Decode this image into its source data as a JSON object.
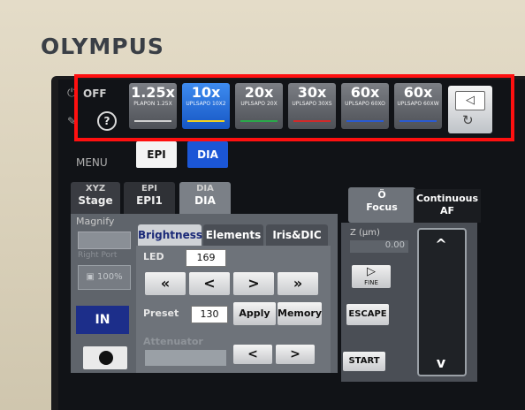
{
  "brand": "OLYMPUS",
  "power": {
    "label": "OFF"
  },
  "help": {
    "label": "?"
  },
  "objectives": [
    {
      "mag": "1.25x",
      "name": "PLAPON 1.25X",
      "stripe": "#cfcfcf",
      "active": false
    },
    {
      "mag": "10x",
      "name": "UPLSAPO 10X2",
      "stripe": "#f0d020",
      "active": true
    },
    {
      "mag": "20x",
      "name": "UPLSAPO 20X",
      "stripe": "#2aa84a",
      "active": false
    },
    {
      "mag": "30x",
      "name": "UPLSAPO 30XS",
      "stripe": "#d02a2a",
      "active": false
    },
    {
      "mag": "60x",
      "name": "UPLSAPO 60XO",
      "stripe": "#2a5ad0",
      "active": false
    },
    {
      "mag": "60x",
      "name": "UPLSAPO 60XW",
      "stripe": "#2a5ad0",
      "active": false
    }
  ],
  "menu": {
    "label": "MENU"
  },
  "light_mode": {
    "epi": "EPI",
    "dia": "DIA"
  },
  "tabs": [
    {
      "icon": "XYZ",
      "label": "Stage"
    },
    {
      "icon": "EPI",
      "label": "EPI1"
    },
    {
      "icon": "DIA",
      "label": "DIA"
    }
  ],
  "left": {
    "magnify": "Magnify",
    "light_path": "Right Port",
    "camera_percent": "100%",
    "in_label": "IN"
  },
  "subtabs": [
    "Brightness",
    "Elements",
    "Iris&DIC"
  ],
  "brightness": {
    "led_label": "LED",
    "led_value": "169",
    "arrows": [
      "«",
      "<",
      ">",
      "»"
    ],
    "preset_label": "Preset",
    "preset_value": "130",
    "apply": "Apply",
    "memory": "Memory",
    "attenuator_label": "Attenuator",
    "att_arrows": [
      "<",
      ">"
    ]
  },
  "focus": {
    "label": "Focus",
    "continuous": "Continuous AF",
    "z_label": "Z (μm)",
    "z_value": "0.00",
    "fine": "FINE",
    "escape": "ESCAPE",
    "start": "START",
    "up": "^",
    "down": "v"
  },
  "colors": {
    "highlight": "#ff1010",
    "active": "#1b56d6"
  }
}
